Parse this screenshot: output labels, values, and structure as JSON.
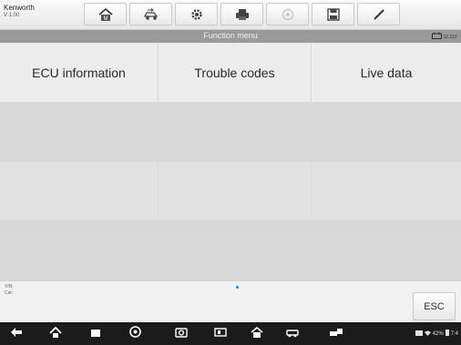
{
  "app": {
    "brand": "Kenworth",
    "version": "V 1.00"
  },
  "toolbar": {
    "buttons": [
      {
        "name": "home-button",
        "icon": "home-icon"
      },
      {
        "name": "vehicle-swap-button",
        "icon": "car-swap-icon"
      },
      {
        "name": "settings-button",
        "icon": "gear-icon"
      },
      {
        "name": "print-button",
        "icon": "printer-icon"
      },
      {
        "name": "help-button",
        "icon": "help-icon",
        "disabled": true
      },
      {
        "name": "save-button",
        "icon": "save-icon"
      },
      {
        "name": "edit-button",
        "icon": "pen-icon"
      }
    ]
  },
  "status": {
    "title": "Function menu",
    "voltage": "12.11V"
  },
  "menu": {
    "items": [
      "ECU information",
      "Trouble codes",
      "Live data"
    ]
  },
  "footer": {
    "vin_label": "VIN:",
    "car_label": "Car:",
    "esc_label": "ESC"
  },
  "system": {
    "battery": "42%",
    "time": "7:4"
  },
  "colors": {
    "accent": "#1e88e5",
    "navbar": "#1b1b1b"
  }
}
